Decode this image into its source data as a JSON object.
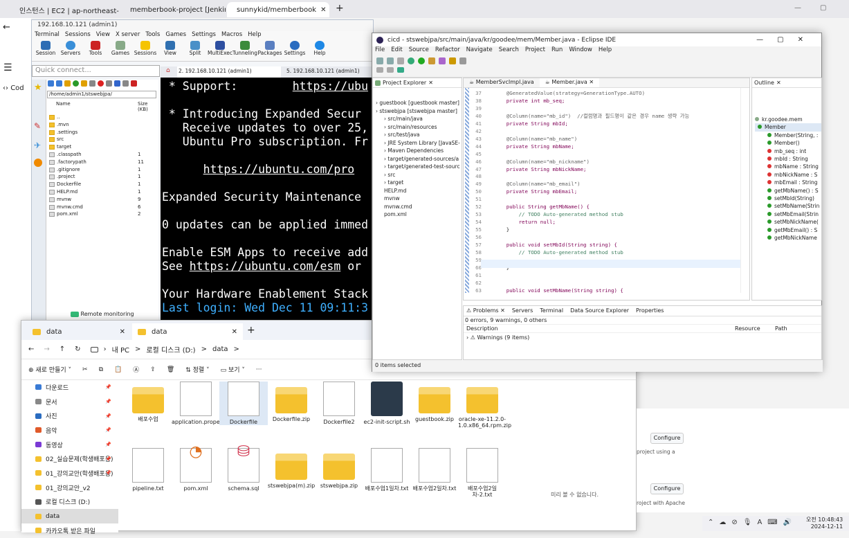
{
  "browser": {
    "tabs": [
      {
        "label": "인스턴스 | EC2 | ap-northeast-"
      },
      {
        "label": "memberbook-project [Jenkins]"
      },
      {
        "label": "sunnykid/memberbook"
      }
    ],
    "new_tab": "+",
    "left_code_label": "Cod",
    "window_controls": [
      "—",
      "▢"
    ]
  },
  "moba": {
    "title": "192.168.10.121 (admin1)",
    "menu": [
      "Terminal",
      "Sessions",
      "View",
      "X server",
      "Tools",
      "Games",
      "Settings",
      "Macros",
      "Help"
    ],
    "toolbar": [
      "Session",
      "Servers",
      "Tools",
      "Games",
      "Sessions",
      "View",
      "Split",
      "MultiExec",
      "Tunneling",
      "Packages",
      "Settings",
      "Help"
    ],
    "quick_placeholder": "Quick connect...",
    "path": "/home/admin1/stswebjpa/",
    "file_headers": [
      "Name",
      "Size (KB)"
    ],
    "files": [
      {
        "name": "..",
        "size": ""
      },
      {
        "name": ".mvn",
        "size": ""
      },
      {
        "name": ".settings",
        "size": ""
      },
      {
        "name": "src",
        "size": ""
      },
      {
        "name": "target",
        "size": ""
      },
      {
        "name": ".classpath",
        "size": "1"
      },
      {
        "name": ".factorypath",
        "size": "11"
      },
      {
        "name": ".gitignore",
        "size": "1"
      },
      {
        "name": ".project",
        "size": "1"
      },
      {
        "name": "Dockerfile",
        "size": "1"
      },
      {
        "name": "HELP.md",
        "size": "1"
      },
      {
        "name": "mvnw",
        "size": "9"
      },
      {
        "name": "mvnw.cmd",
        "size": "6"
      },
      {
        "name": "pom.xml",
        "size": "2"
      }
    ],
    "remote_monitoring": "Remote monitoring",
    "term_tabs": [
      "2. 192.168.10.121 (admin1)",
      "5. 192.168.10.121 (admin1)"
    ],
    "terminal_lines": [
      " * Support:        https://ubu",
      " ",
      " * Introducing Expanded Secur",
      "   Receive updates to over 25,",
      "   Ubuntu Pro subscription. Fr",
      " ",
      "      https://ubuntu.com/pro",
      " ",
      "Expanded Security Maintenance",
      " ",
      "0 updates can be applied immed",
      " ",
      "Enable ESM Apps to receive add",
      "See https://ubuntu.com/esm or",
      " ",
      "Your Hardware Enablement Stack",
      "Last login: Wed Dec 11 09:11:3"
    ]
  },
  "explorer": {
    "tabs": [
      "data",
      "data"
    ],
    "breadcrumb": [
      "내 PC",
      ">",
      "로컬 디스크 (D:)",
      ">",
      "data",
      ">"
    ],
    "new_button": "새로 만들기",
    "sort": "정렬",
    "view": "보기",
    "more": "···",
    "nav": [
      "다운로드",
      "문서",
      "사진",
      "음악",
      "동영상",
      "02_실습문제(학생배포용)",
      "01_강의교안(학생배포용)",
      "01_강의교안_v2",
      "로컬 디스크 (D:)",
      "data",
      "카카오톡 받은 파일"
    ],
    "files": [
      "배포수업",
      "application.properties",
      "Dockerfile",
      "Dockerfile.zip",
      "Dockerfile2",
      "ec2-init-script.sh",
      "guestbook.zip",
      "oracle-xe-11.2.0-1.0.x86_64.rpm.zip",
      "pipeline.txt",
      "pom.xml",
      "schema.sql",
      "stswebjpa(m).zip",
      "stswebjpa.zip",
      "배포수업1일차.txt",
      "배포수업2일차.txt",
      "배포수업2일차-2.txt"
    ],
    "preview": "미리 볼 수 없습니다."
  },
  "eclipse": {
    "title": "cicd - stswebjpa/src/main/java/kr/goodee/mem/Member.java - Eclipse IDE",
    "menu": [
      "File",
      "Edit",
      "Source",
      "Refactor",
      "Navigate",
      "Search",
      "Project",
      "Run",
      "Window",
      "Help"
    ],
    "project_explorer": "Project Explorer",
    "tree": [
      "guestbook [guestbook master]",
      "stswebjpa [stswebjpa master]",
      "src/main/java",
      "src/main/resources",
      "src/test/java",
      "JRE System Library [JavaSE-",
      "Maven Dependencies",
      "target/generated-sources/a",
      "target/generated-test-sourc",
      "src",
      "target",
      "HELP.md",
      "mvnw",
      "mvnw.cmd",
      "pom.xml"
    ],
    "editor_tabs": [
      "MemberSvcImpl.java",
      "Member.java"
    ],
    "code_lines": [
      {
        "n": "37",
        "t": "    @GeneratedValue(strategy=GenerationType.AUTO)"
      },
      {
        "n": "38",
        "t": "    private int mb_seq;"
      },
      {
        "n": "39",
        "t": ""
      },
      {
        "n": "40",
        "t": "    @Column(name=\"mb_id\")  //컬럼명과 필드명이 같은 경우 name 생략 가능"
      },
      {
        "n": "41",
        "t": "    private String mbId;"
      },
      {
        "n": "42",
        "t": ""
      },
      {
        "n": "43",
        "t": "    @Column(name=\"mb_name\")"
      },
      {
        "n": "44",
        "t": "    private String mbName;"
      },
      {
        "n": "45",
        "t": ""
      },
      {
        "n": "46",
        "t": "    @Column(name=\"mb_nickname\")"
      },
      {
        "n": "47",
        "t": "    private String mbNickName;"
      },
      {
        "n": "48",
        "t": ""
      },
      {
        "n": "49",
        "t": "    @Column(name=\"mb_email\")"
      },
      {
        "n": "50",
        "t": "    private String mbEmail;"
      },
      {
        "n": "51",
        "t": ""
      },
      {
        "n": "52",
        "t": "    public String getMbName() {"
      },
      {
        "n": "53",
        "t": "        // TODO Auto-generated method stub"
      },
      {
        "n": "54",
        "t": "        return null;"
      },
      {
        "n": "55",
        "t": "    }"
      },
      {
        "n": "56",
        "t": ""
      },
      {
        "n": "57",
        "t": "    public void setMbId(String string) {"
      },
      {
        "n": "58",
        "t": "        // TODO Auto-generated method stub"
      },
      {
        "n": "59",
        "t": ""
      },
      {
        "n": "60",
        "t": "    }"
      },
      {
        "n": "61",
        "t": ""
      },
      {
        "n": "62",
        "t": ""
      },
      {
        "n": "63",
        "t": "    public void setMbName(String string) {"
      }
    ],
    "outline": "Outline",
    "outline_items": [
      "kr.goodee.mem",
      "Member",
      "Member(String, :",
      "Member()",
      "mb_seq : int",
      "mbId : String",
      "mbName : String",
      "mbNickName : S",
      "mbEmail : String",
      "getMbName() : S",
      "setMbId(String)",
      "setMbName(Strin",
      "setMbEmail(Strin",
      "setMbNickName(",
      "getMbEmail() : S",
      "getMbNickName"
    ],
    "bottom_tabs": [
      "Problems",
      "Servers",
      "Terminal",
      "Data Source Explorer",
      "Properties"
    ],
    "problems_summary": "0 errors, 9 warnings, 0 others",
    "problems_cols": [
      "Description",
      "Resource",
      "Path"
    ],
    "warnings": "Warnings (9 items)",
    "status": "0 items selected"
  },
  "github": {
    "configure": [
      "Configure",
      "Configure"
    ],
    "text1": "project using a",
    "text2": "roject with Apache"
  },
  "tray": {
    "time": "오전 10:48:43",
    "date": "2024-12-11"
  }
}
